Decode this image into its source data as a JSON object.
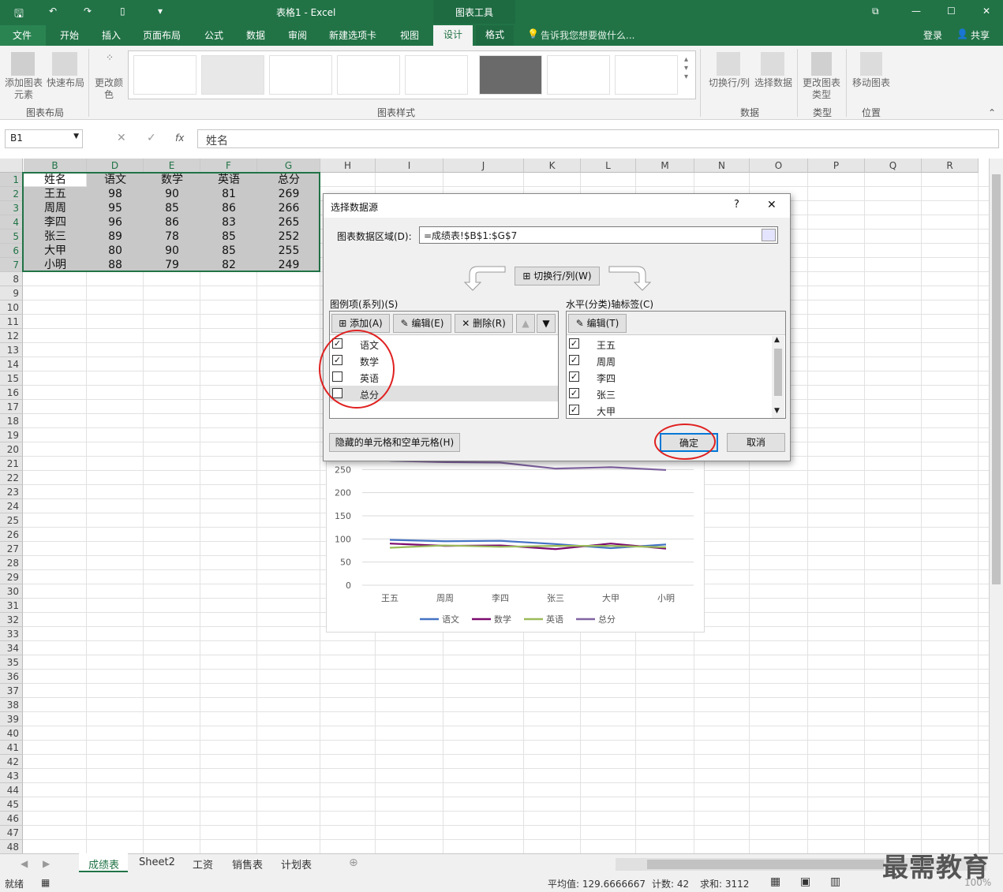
{
  "app": {
    "title": "表格1 - Excel",
    "context_tab_group": "图表工具",
    "login": "登录",
    "share": "共享",
    "tell_me": "告诉我您想要做什么..."
  },
  "ribbon_tabs": [
    "文件",
    "开始",
    "插入",
    "页面布局",
    "公式",
    "数据",
    "审阅",
    "新建选项卡",
    "视图",
    "设计",
    "格式"
  ],
  "ribbon": {
    "add_element": "添加图表元素",
    "quick_layout": "快速布局",
    "change_colors": "更改颜色",
    "switch_row_col": "切换行/列",
    "select_data": "选择数据",
    "change_chart_type": "更改图表类型",
    "move_chart": "移动图表",
    "group_layout": "图表布局",
    "group_styles": "图表样式",
    "group_data": "数据",
    "group_type": "类型",
    "group_location": "位置"
  },
  "formula_bar": {
    "name_box": "B1",
    "fx": "fx",
    "content": "姓名"
  },
  "columns": [
    "B",
    "D",
    "E",
    "F",
    "G",
    "H",
    "I",
    "J",
    "K",
    "L",
    "M",
    "N",
    "O",
    "P",
    "Q",
    "R"
  ],
  "rows": [
    "1",
    "2",
    "3",
    "4",
    "5",
    "6",
    "7",
    "8",
    "9",
    "10",
    "11",
    "12",
    "13",
    "14",
    "15",
    "16",
    "17",
    "18",
    "19",
    "20",
    "21",
    "22",
    "23",
    "24",
    "25",
    "26",
    "27",
    "28",
    "29",
    "30",
    "31",
    "32",
    "33",
    "34",
    "35",
    "36",
    "37",
    "38",
    "39",
    "40",
    "41",
    "42",
    "43",
    "44",
    "45",
    "46",
    "47",
    "48"
  ],
  "table": {
    "headers": [
      "姓名",
      "语文",
      "数学",
      "英语",
      "总分"
    ],
    "rows": [
      [
        "王五",
        "98",
        "90",
        "81",
        "269"
      ],
      [
        "周周",
        "95",
        "85",
        "86",
        "266"
      ],
      [
        "李四",
        "96",
        "86",
        "83",
        "265"
      ],
      [
        "张三",
        "89",
        "78",
        "85",
        "252"
      ],
      [
        "大甲",
        "80",
        "90",
        "85",
        "255"
      ],
      [
        "小明",
        "88",
        "79",
        "82",
        "249"
      ]
    ]
  },
  "chart_data": {
    "type": "line",
    "categories": [
      "王五",
      "周周",
      "李四",
      "张三",
      "大甲",
      "小明"
    ],
    "series": [
      {
        "name": "语文",
        "values": [
          98,
          95,
          96,
          89,
          80,
          88
        ],
        "color": "#4472c4"
      },
      {
        "name": "数学",
        "values": [
          90,
          85,
          86,
          78,
          90,
          79
        ],
        "color": "#7b0a6e"
      },
      {
        "name": "英语",
        "values": [
          81,
          86,
          83,
          85,
          85,
          82
        ],
        "color": "#9bbb59"
      },
      {
        "name": "总分",
        "values": [
          269,
          266,
          265,
          252,
          255,
          249
        ],
        "color": "#8064a2"
      }
    ],
    "y_ticks": [
      "250",
      "200",
      "150",
      "100",
      "50",
      "0"
    ],
    "ylim": [
      0,
      300
    ],
    "legend": "bottom"
  },
  "dialog": {
    "title": "选择数据源",
    "help": "?",
    "close": "✕",
    "range_label": "图表数据区域(D):",
    "range_value": "=成绩表!$B$1:$G$7",
    "switch_button": "切换行/列(W)",
    "legend_label": "图例项(系列)(S)",
    "axis_label": "水平(分类)轴标签(C)",
    "add": "添加(A)",
    "edit": "编辑(E)",
    "delete": "删除(R)",
    "edit_axis": "编辑(T)",
    "series_items": [
      {
        "label": "语文",
        "checked": true
      },
      {
        "label": "数学",
        "checked": true
      },
      {
        "label": "英语",
        "checked": false
      },
      {
        "label": "总分",
        "checked": false
      }
    ],
    "axis_items": [
      {
        "label": "王五",
        "checked": true
      },
      {
        "label": "周周",
        "checked": true
      },
      {
        "label": "李四",
        "checked": true
      },
      {
        "label": "张三",
        "checked": true
      },
      {
        "label": "大甲",
        "checked": true
      }
    ],
    "hidden_cells": "隐藏的单元格和空单元格(H)",
    "ok": "确定",
    "cancel": "取消"
  },
  "sheets": [
    "成绩表",
    "Sheet2",
    "工资",
    "销售表",
    "计划表"
  ],
  "status": {
    "ready": "就绪",
    "average": "平均值: 129.6666667",
    "count": "计数: 42",
    "sum": "求和: 3112",
    "zoom": "100%"
  },
  "watermark": "最需教育"
}
